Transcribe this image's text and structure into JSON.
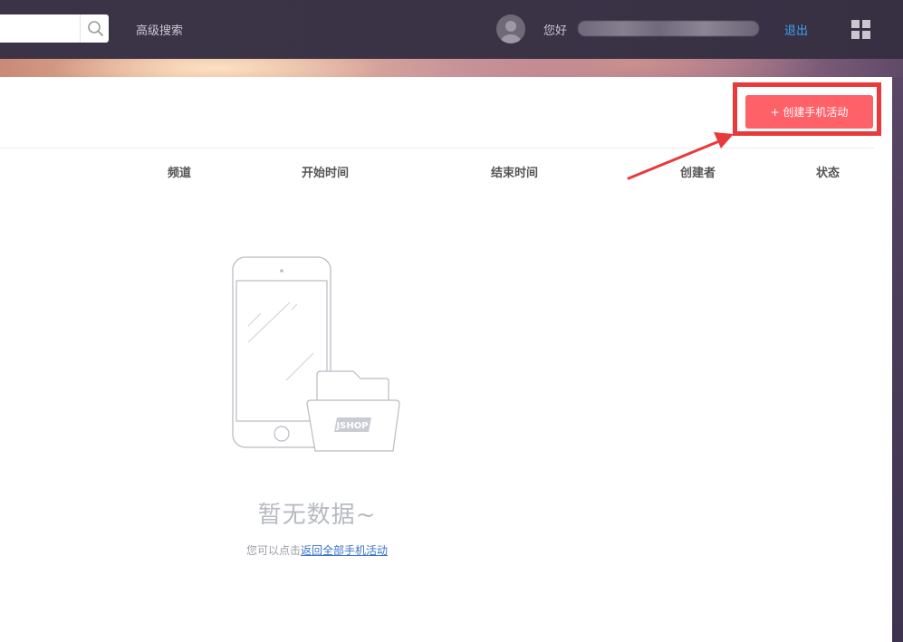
{
  "header": {
    "search": {
      "value": "",
      "placeholder": ""
    },
    "advanced_search_label": "高级搜索",
    "greeting": "您好",
    "logout_label": "退出"
  },
  "toolbar": {
    "create_button_label": "+ 创建手机活动"
  },
  "table": {
    "columns": [
      "频道",
      "开始时间",
      "结束时间",
      "创建者",
      "状态"
    ]
  },
  "empty_state": {
    "title": "暂无数据~",
    "hint_prefix": "您可以点击",
    "hint_link": "返回全部手机活动",
    "illustration_badge": "JSHOP"
  },
  "colors": {
    "accent": "#ff6168",
    "highlight": "#e83a3a",
    "link": "#3fa0f0",
    "topbar": "#3b3447"
  }
}
